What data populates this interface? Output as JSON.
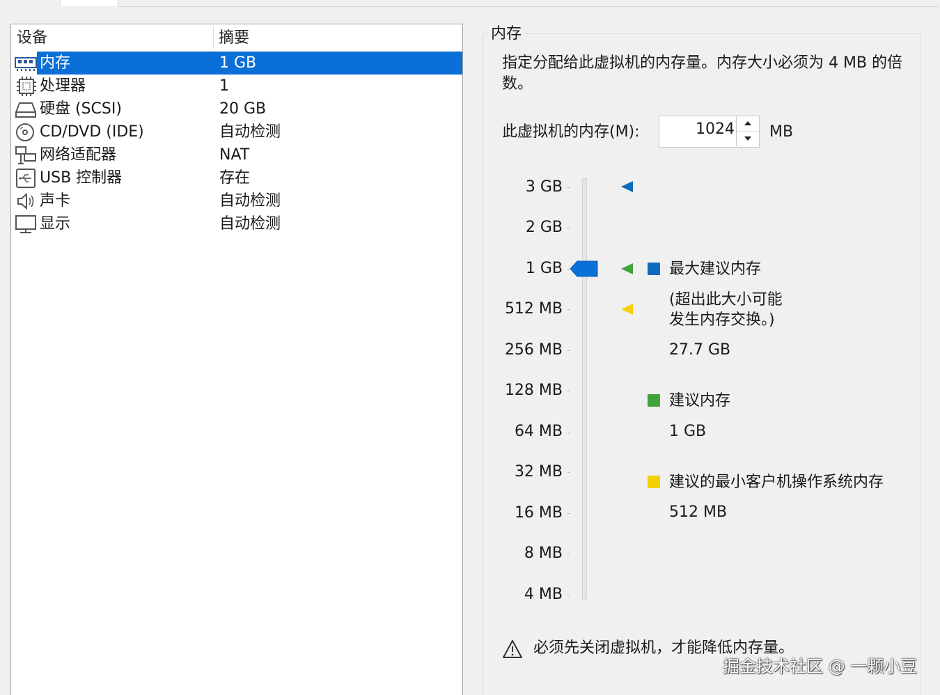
{
  "device_table": {
    "col_device": "设备",
    "col_summary": "摘要",
    "rows": [
      {
        "name": "内存",
        "summary": "1 GB",
        "icon": "memory-icon",
        "selected": true
      },
      {
        "name": "处理器",
        "summary": "1",
        "icon": "processor-icon"
      },
      {
        "name": "硬盘 (SCSI)",
        "summary": "20 GB",
        "icon": "harddisk-icon"
      },
      {
        "name": "CD/DVD (IDE)",
        "summary": "自动检测",
        "icon": "cdrom-icon"
      },
      {
        "name": "网络适配器",
        "summary": "NAT",
        "icon": "network-icon"
      },
      {
        "name": "USB 控制器",
        "summary": "存在",
        "icon": "usb-icon"
      },
      {
        "name": "声卡",
        "summary": "自动检测",
        "icon": "speaker-icon"
      },
      {
        "name": "显示",
        "summary": "自动检测",
        "icon": "display-icon"
      }
    ]
  },
  "memory": {
    "group_title": "内存",
    "description": "指定分配给此虚拟机的内存量。内存大小必须为 4 MB 的倍数。",
    "field_label": "此虚拟机的内存(M):",
    "value": "1024",
    "unit": "MB",
    "slider_ticks": [
      "3 GB",
      "2 GB",
      "1 GB",
      "512 MB",
      "256 MB",
      "128 MB",
      "64 MB",
      "32 MB",
      "16 MB",
      "8 MB",
      "4 MB"
    ],
    "current_tick": "1 GB",
    "legend": {
      "max": {
        "title": "最大建议内存",
        "note_line1": "(超出此大小可能",
        "note_line2": "发生内存交换。)",
        "value": "27.7 GB",
        "color": "#0f6cbd"
      },
      "recommended": {
        "title": "建议内存",
        "value": "1 GB",
        "color": "#3fa33a"
      },
      "min_guest": {
        "title": "建议的最小客户机操作系统内存",
        "value": "512 MB",
        "color": "#f5d000"
      }
    },
    "warning": "必须先关闭虚拟机，才能降低内存量。"
  },
  "watermark": "掘金技术社区 @ 一颗小豆"
}
